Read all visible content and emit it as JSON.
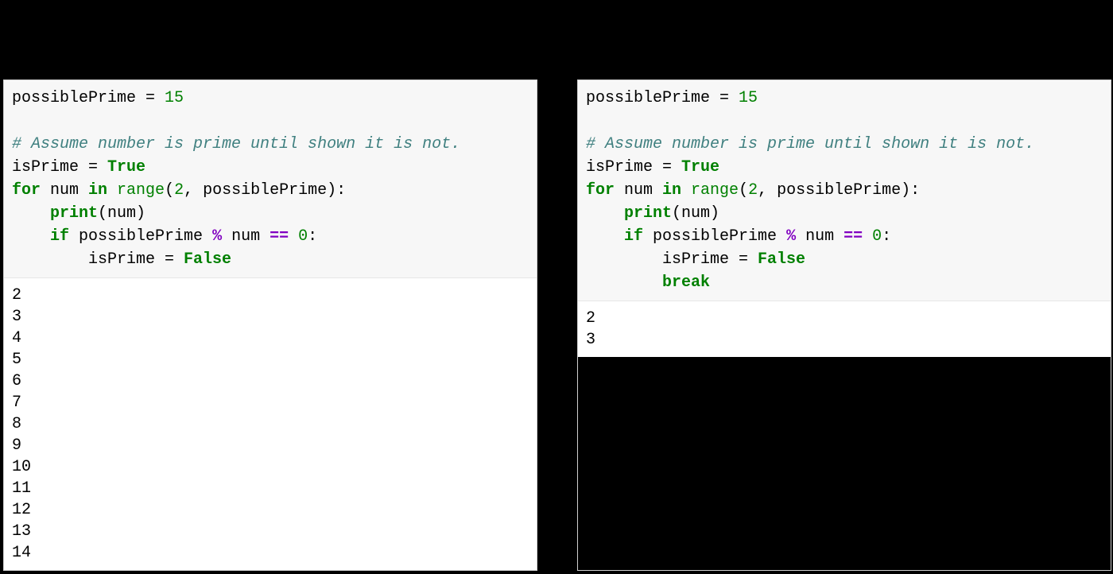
{
  "left": {
    "code": {
      "l1_var": "possiblePrime",
      "l1_eq": " = ",
      "l1_num": "15",
      "l3_comment": "# Assume number is prime until shown it is not.",
      "l4_var": "isPrime",
      "l4_eq": " = ",
      "l4_bool": "True",
      "l5_for": "for",
      "l5_num": " num ",
      "l5_in": "in",
      "l5_range": " range",
      "l5_open": "(",
      "l5_two": "2",
      "l5_comma": ", possiblePrime):",
      "l6_indent": "    ",
      "l6_print": "print",
      "l6_open": "(num)",
      "l7_indent": "    ",
      "l7_if": "if",
      "l7_possiblePrime": " possiblePrime ",
      "l7_mod": "%",
      "l7_num": " num ",
      "l7_eq": "==",
      "l7_zero": " 0",
      "l7_colon": ":",
      "l8_indent": "        isPrime ",
      "l8_eq": "= ",
      "l8_false": "False"
    },
    "output": "2\n3\n4\n5\n6\n7\n8\n9\n10\n11\n12\n13\n14"
  },
  "right": {
    "code": {
      "l1_var": "possiblePrime",
      "l1_eq": " = ",
      "l1_num": "15",
      "l3_comment": "# Assume number is prime until shown it is not.",
      "l4_var": "isPrime",
      "l4_eq": " = ",
      "l4_bool": "True",
      "l5_for": "for",
      "l5_num": " num ",
      "l5_in": "in",
      "l5_range": " range",
      "l5_open": "(",
      "l5_two": "2",
      "l5_comma": ", possiblePrime):",
      "l6_indent": "    ",
      "l6_print": "print",
      "l6_open": "(num)",
      "l7_indent": "    ",
      "l7_if": "if",
      "l7_possiblePrime": " possiblePrime ",
      "l7_mod": "%",
      "l7_num": " num ",
      "l7_eq": "==",
      "l7_zero": " 0",
      "l7_colon": ":",
      "l8_indent": "        isPrime ",
      "l8_eq": "= ",
      "l8_false": "False",
      "l9_indent": "        ",
      "l9_break": "break"
    },
    "output": "2\n3"
  }
}
